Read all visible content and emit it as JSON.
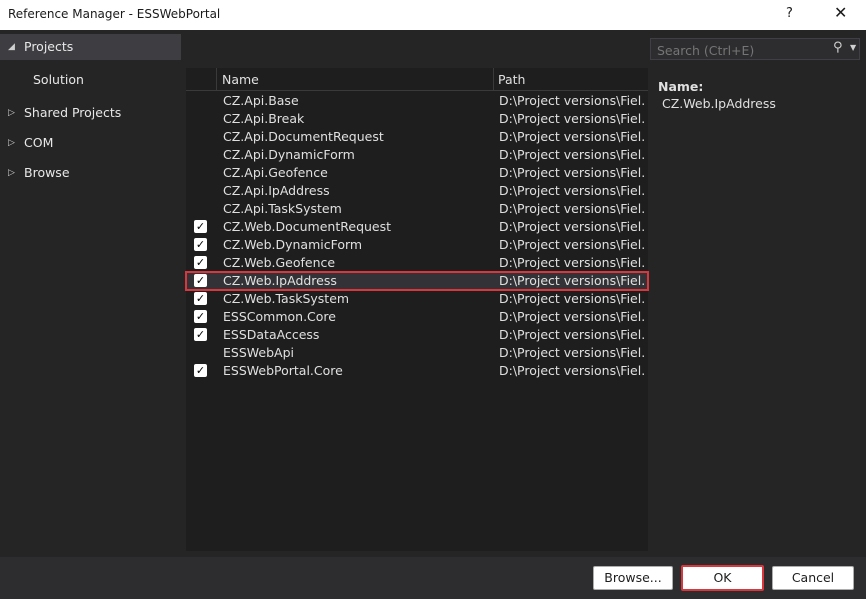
{
  "window": {
    "title": "Reference Manager - ESSWebPortal",
    "help": "?",
    "close": "✕"
  },
  "sidebar": {
    "items": [
      {
        "label": "Projects",
        "expanded": true
      },
      {
        "label": "Solution",
        "child": true
      },
      {
        "label": "Shared Projects"
      },
      {
        "label": "COM"
      },
      {
        "label": "Browse"
      }
    ]
  },
  "search": {
    "placeholder": "Search (Ctrl+E)"
  },
  "table": {
    "headers": {
      "name": "Name",
      "path": "Path"
    },
    "rows": [
      {
        "name": "CZ.Api.Base",
        "path": "D:\\Project versions\\Fiel...",
        "checked": false
      },
      {
        "name": "CZ.Api.Break",
        "path": "D:\\Project versions\\Fiel...",
        "checked": false
      },
      {
        "name": "CZ.Api.DocumentRequest",
        "path": "D:\\Project versions\\Fiel...",
        "checked": false
      },
      {
        "name": "CZ.Api.DynamicForm",
        "path": "D:\\Project versions\\Fiel...",
        "checked": false
      },
      {
        "name": "CZ.Api.Geofence",
        "path": "D:\\Project versions\\Fiel...",
        "checked": false
      },
      {
        "name": "CZ.Api.IpAddress",
        "path": "D:\\Project versions\\Fiel...",
        "checked": false
      },
      {
        "name": "CZ.Api.TaskSystem",
        "path": "D:\\Project versions\\Fiel...",
        "checked": false
      },
      {
        "name": "CZ.Web.DocumentRequest",
        "path": "D:\\Project versions\\Fiel...",
        "checked": true
      },
      {
        "name": "CZ.Web.DynamicForm",
        "path": "D:\\Project versions\\Fiel...",
        "checked": true
      },
      {
        "name": "CZ.Web.Geofence",
        "path": "D:\\Project versions\\Fiel...",
        "checked": true
      },
      {
        "name": "CZ.Web.IpAddress",
        "path": "D:\\Project versions\\Fiel...",
        "checked": true,
        "selected": true
      },
      {
        "name": "CZ.Web.TaskSystem",
        "path": "D:\\Project versions\\Fiel...",
        "checked": true
      },
      {
        "name": "ESSCommon.Core",
        "path": "D:\\Project versions\\Fiel...",
        "checked": true
      },
      {
        "name": "ESSDataAccess",
        "path": "D:\\Project versions\\Fiel...",
        "checked": true
      },
      {
        "name": "ESSWebApi",
        "path": "D:\\Project versions\\Fiel...",
        "checked": false
      },
      {
        "name": "ESSWebPortal.Core",
        "path": "D:\\Project versions\\Fiel...",
        "checked": true
      }
    ]
  },
  "details": {
    "label": "Name:",
    "value": "CZ.Web.IpAddress"
  },
  "footer": {
    "browse": "Browse...",
    "ok": "OK",
    "cancel": "Cancel"
  },
  "colors": {
    "highlight_outline": "#d9363e",
    "selected_row": "#333337"
  }
}
